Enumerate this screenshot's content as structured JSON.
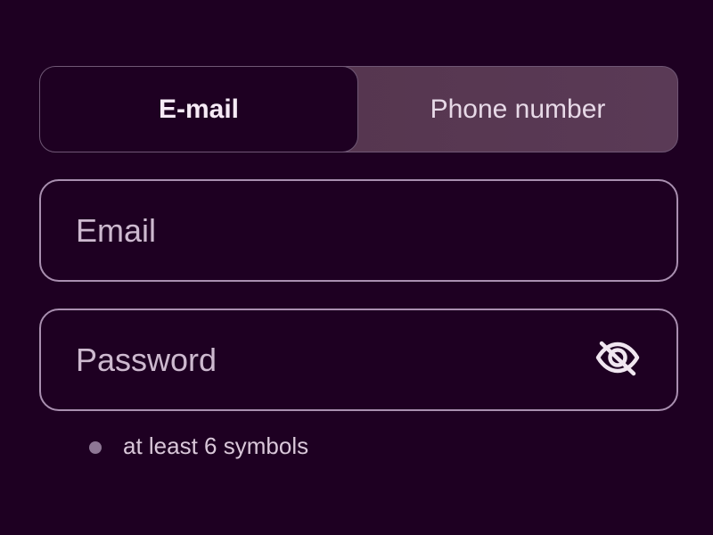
{
  "tabs": {
    "email": {
      "label": "E-mail",
      "active": true
    },
    "phone": {
      "label": "Phone number",
      "active": false
    }
  },
  "fields": {
    "email": {
      "placeholder": "Email",
      "value": ""
    },
    "password": {
      "placeholder": "Password",
      "value": ""
    }
  },
  "password": {
    "toggle_icon": "eye-off-icon"
  },
  "hint": {
    "text": "at least 6 symbols",
    "bullet_color": "#8e7795"
  },
  "colors": {
    "background": "#1e0022",
    "border": "#a98fb0",
    "text": "#f3e9f3",
    "tab_inactive_bg": "#5a3a56"
  }
}
